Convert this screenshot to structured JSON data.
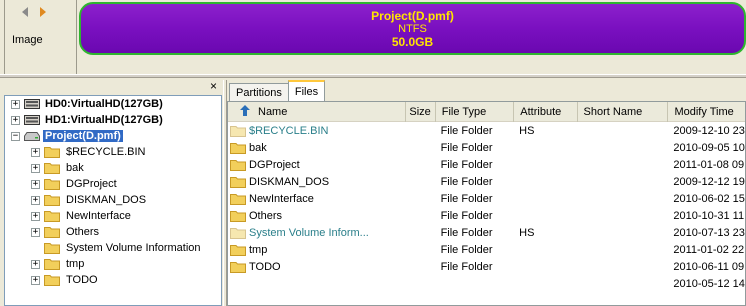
{
  "header": {
    "image_label": "Image",
    "back_icon": "left-arrow-icon",
    "forward_icon": "right-arrow-icon"
  },
  "partition_bar": {
    "name": "Project(D.pmf)",
    "filesystem": "NTFS",
    "size": "50.0GB",
    "fill_color": "#7a10c0",
    "border_color": "#2fb52f",
    "text_color": "#ffe400"
  },
  "tree": {
    "close_glyph": "×",
    "items": [
      {
        "label": "HD0:VirtualHD(127GB)",
        "expander": "+",
        "icon": "hard-disk-icon",
        "bold": true
      },
      {
        "label": "HD1:VirtualHD(127GB)",
        "expander": "+",
        "icon": "hard-disk-icon",
        "bold": true
      },
      {
        "label": "Project(D.pmf)",
        "expander": "−",
        "icon": "image-drive-icon",
        "bold": true,
        "selected": true
      },
      {
        "label": "$RECYCLE.BIN",
        "expander": "+",
        "icon": "folder-icon"
      },
      {
        "label": "bak",
        "expander": "+",
        "icon": "folder-icon"
      },
      {
        "label": "DGProject",
        "expander": "+",
        "icon": "folder-icon"
      },
      {
        "label": "DISKMAN_DOS",
        "expander": "+",
        "icon": "folder-icon"
      },
      {
        "label": "NewInterface",
        "expander": "+",
        "icon": "folder-icon"
      },
      {
        "label": "Others",
        "expander": "+",
        "icon": "folder-icon"
      },
      {
        "label": "System Volume Information",
        "expander": "",
        "icon": "folder-icon"
      },
      {
        "label": "tmp",
        "expander": "+",
        "icon": "folder-icon"
      },
      {
        "label": "TODO",
        "expander": "+",
        "icon": "folder-icon"
      }
    ]
  },
  "tabs": [
    {
      "label": "Partitions",
      "active": false
    },
    {
      "label": "Files",
      "active": true
    }
  ],
  "file_list": {
    "columns": {
      "name": "Name",
      "size": "Size",
      "type": "File Type",
      "attribute": "Attribute",
      "short_name": "Short Name",
      "modify_time": "Modify Time"
    },
    "rows": [
      {
        "name": "$RECYCLE.BIN",
        "size": "",
        "type": "File Folder",
        "attribute": "HS",
        "short_name": "",
        "modify_time": "2009-12-10 23:",
        "hidden": true
      },
      {
        "name": "bak",
        "size": "",
        "type": "File Folder",
        "attribute": "",
        "short_name": "",
        "modify_time": "2010-09-05 10:5",
        "hidden": false
      },
      {
        "name": "DGProject",
        "size": "",
        "type": "File Folder",
        "attribute": "",
        "short_name": "",
        "modify_time": "2011-01-08 09:",
        "hidden": false
      },
      {
        "name": "DISKMAN_DOS",
        "size": "",
        "type": "File Folder",
        "attribute": "",
        "short_name": "",
        "modify_time": "2009-12-12 19:3",
        "hidden": false
      },
      {
        "name": "NewInterface",
        "size": "",
        "type": "File Folder",
        "attribute": "",
        "short_name": "",
        "modify_time": "2010-06-02 15:",
        "hidden": false
      },
      {
        "name": "Others",
        "size": "",
        "type": "File Folder",
        "attribute": "",
        "short_name": "",
        "modify_time": "2010-10-31 11:",
        "hidden": false
      },
      {
        "name": "System Volume Inform...",
        "size": "",
        "type": "File Folder",
        "attribute": "HS",
        "short_name": "",
        "modify_time": "2010-07-13 23:0",
        "hidden": true
      },
      {
        "name": "tmp",
        "size": "",
        "type": "File Folder",
        "attribute": "",
        "short_name": "",
        "modify_time": "2011-01-02 22:",
        "hidden": false
      },
      {
        "name": "TODO",
        "size": "",
        "type": "File Folder",
        "attribute": "",
        "short_name": "",
        "modify_time": "2010-06-11 09:",
        "hidden": false
      },
      {
        "name": "",
        "size": "",
        "type": "",
        "attribute": "",
        "short_name": "",
        "modify_time": "2010-05-12 14:5",
        "hidden": false
      }
    ]
  }
}
